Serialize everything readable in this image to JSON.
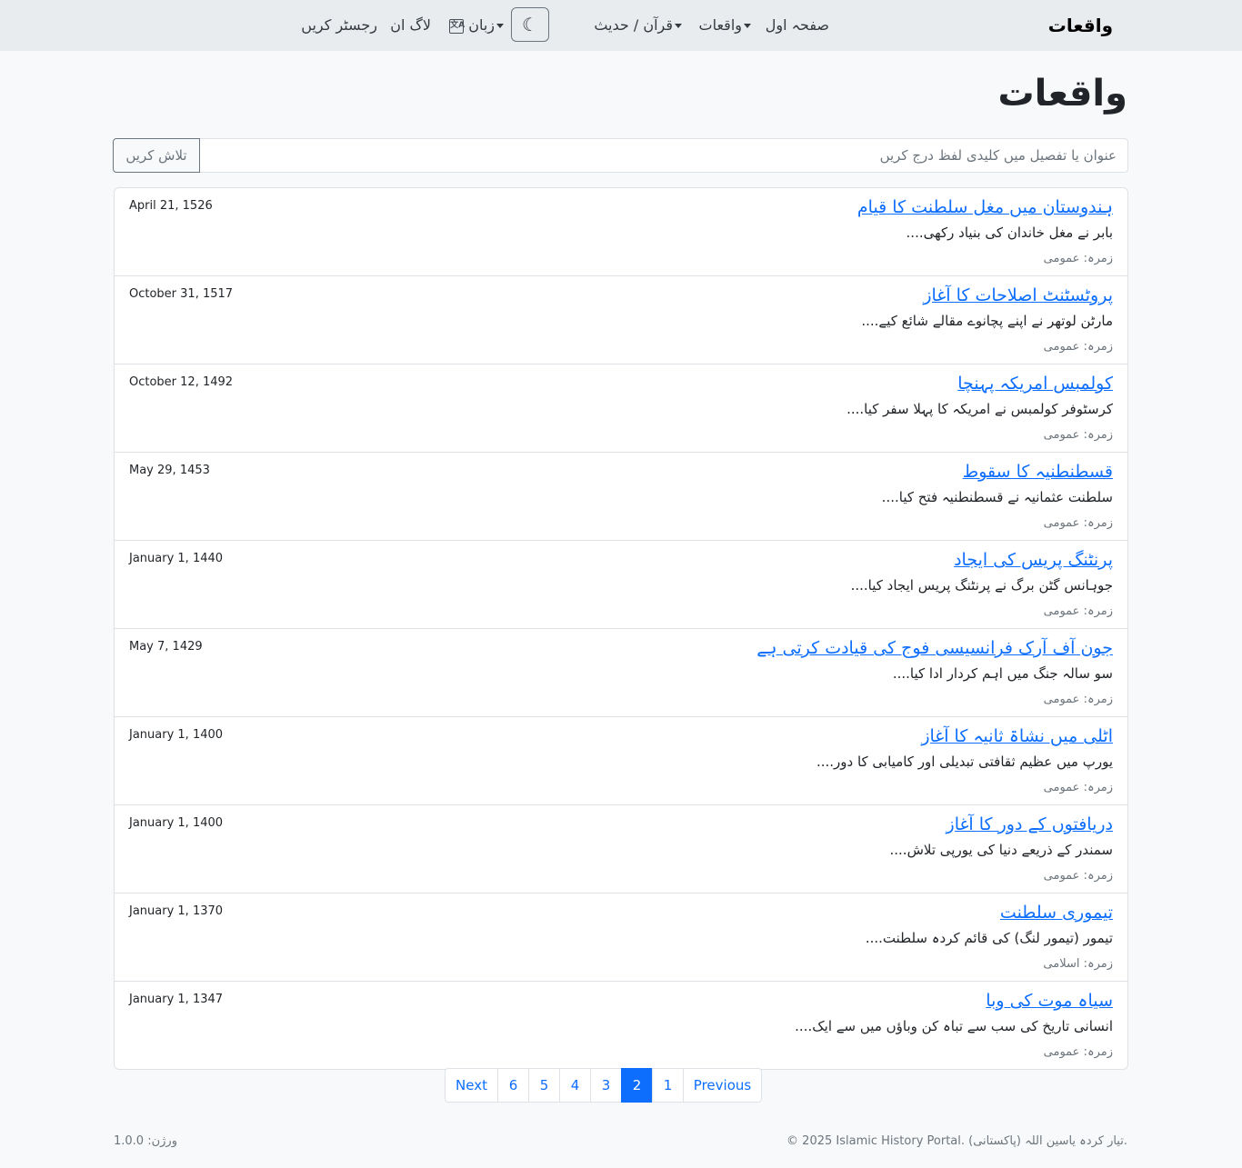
{
  "navbar": {
    "brand": "واقعات",
    "home": "صفحہ اول",
    "events": "واقعات",
    "quran_hadith": "قرآن / حدیث",
    "language": "زبان",
    "language_icon_glyph": "文A",
    "theme_icon_glyph": "☾",
    "login": "لاگ ان",
    "register": "رجسٹر کریں"
  },
  "page": {
    "title": "واقعات"
  },
  "search": {
    "placeholder": "عنوان یا تفصیل میں کلیدی لفظ درج کریں",
    "button": "تلاش کریں"
  },
  "events": [
    {
      "title": "ہندوستان میں مغل سلطنت کا قیام",
      "desc": "بابر نے مغل خاندان کی بنیاد رکھی....",
      "category": "زمرہ: عمومی",
      "date": "April 21, 1526"
    },
    {
      "title": "پروٹسٹنٹ اصلاحات کا آغاز",
      "desc": "مارٹن لوتھر نے اپنے پچانوے مقالے شائع کیے....",
      "category": "زمرہ: عمومی",
      "date": "October 31, 1517"
    },
    {
      "title": "کولمبس امریکہ پہنچا",
      "desc": "کرسٹوفر کولمبس نے امریکہ کا پہلا سفر کیا....",
      "category": "زمرہ: عمومی",
      "date": "October 12, 1492"
    },
    {
      "title": "قسطنطنیہ کا سقوط",
      "desc": "سلطنت عثمانیہ نے قسطنطنیہ فتح کیا....",
      "category": "زمرہ: عمومی",
      "date": "May 29, 1453"
    },
    {
      "title": "پرنٹنگ پریس کی ایجاد",
      "desc": "جوہانس گٹن برگ نے پرنٹنگ پریس ایجاد کیا....",
      "category": "زمرہ: عمومی",
      "date": "January 1, 1440"
    },
    {
      "title": "جون آف آرک فرانسیسی فوج کی قیادت کرتی ہے",
      "desc": "سو سالہ جنگ میں اہم کردار ادا کیا....",
      "category": "زمرہ: عمومی",
      "date": "May 7, 1429"
    },
    {
      "title": "اٹلی میں نشاۃ ثانیہ کا آغاز",
      "desc": "یورپ میں عظیم ثقافتی تبدیلی اور کامیابی کا دور....",
      "category": "زمرہ: عمومی",
      "date": "January 1, 1400"
    },
    {
      "title": "دریافتوں کے دور کا آغاز",
      "desc": "سمندر کے ذریعے دنیا کی یورپی تلاش....",
      "category": "زمرہ: عمومی",
      "date": "January 1, 1400"
    },
    {
      "title": "تیموری سلطنت",
      "desc": "تیمور (تیمور لنگ) کی قائم کردہ سلطنت....",
      "category": "زمرہ: اسلامی",
      "date": "January 1, 1370"
    },
    {
      "title": "سیاہ موت کی وبا",
      "desc": "انسانی تاریخ کی سب سے تباہ کن وباؤں میں سے ایک....",
      "category": "زمرہ: عمومی",
      "date": "January 1, 1347"
    }
  ],
  "pagination": {
    "next": "Next",
    "previous": "Previous",
    "pages": [
      "6",
      "5",
      "4",
      "3",
      "2",
      "1"
    ],
    "active": "2"
  },
  "footer": {
    "copyright": "© 2025 Islamic History Portal. تیار کردہ یاسین اللہ (پاکستانی).",
    "version": "ورژن: 1.0.0"
  },
  "colors": {
    "link": "#0d6efd",
    "navbar_bg": "#e9ecef",
    "page_bg": "#f8f9fa"
  }
}
